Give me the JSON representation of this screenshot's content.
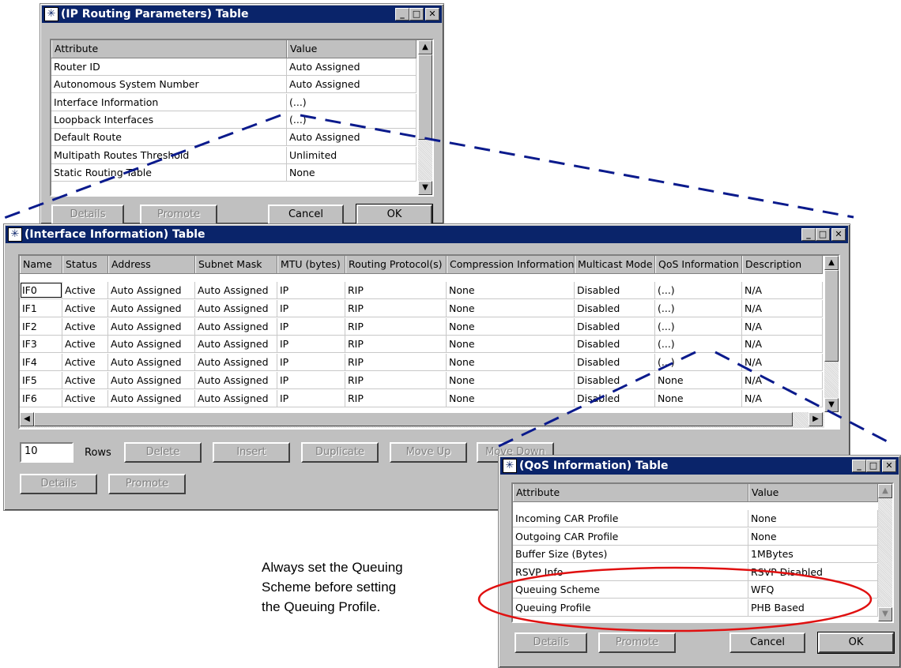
{
  "ip_window": {
    "title": "(IP Routing Parameters) Table",
    "columns": [
      "Attribute",
      "Value"
    ],
    "rows": [
      [
        "Router ID",
        "Auto Assigned"
      ],
      [
        "Autonomous System Number",
        "Auto Assigned"
      ],
      [
        "Interface Information",
        "(...)"
      ],
      [
        "Loopback Interfaces",
        "(...)"
      ],
      [
        "Default Route",
        "Auto Assigned"
      ],
      [
        "Multipath Routes Threshold",
        "Unlimited"
      ],
      [
        "Static Routing Table",
        "None"
      ]
    ],
    "buttons": {
      "details": "Details",
      "promote": "Promote",
      "cancel": "Cancel",
      "ok": "OK"
    }
  },
  "iface_window": {
    "title": "(Interface Information) Table",
    "columns": [
      "Name",
      "Status",
      "Address",
      "Subnet Mask",
      "MTU (bytes)",
      "Routing Protocol(s)",
      "Compression Information",
      "Multicast Mode",
      "QoS Information",
      "Description"
    ],
    "rows": [
      [
        "IF0",
        "Active",
        "Auto Assigned",
        "Auto Assigned",
        "IP",
        "RIP",
        "None",
        "Disabled",
        "(...)",
        "N/A"
      ],
      [
        "IF1",
        "Active",
        "Auto Assigned",
        "Auto Assigned",
        "IP",
        "RIP",
        "None",
        "Disabled",
        "(...)",
        "N/A"
      ],
      [
        "IF2",
        "Active",
        "Auto Assigned",
        "Auto Assigned",
        "IP",
        "RIP",
        "None",
        "Disabled",
        "(...)",
        "N/A"
      ],
      [
        "IF3",
        "Active",
        "Auto Assigned",
        "Auto Assigned",
        "IP",
        "RIP",
        "None",
        "Disabled",
        "(...)",
        "N/A"
      ],
      [
        "IF4",
        "Active",
        "Auto Assigned",
        "Auto Assigned",
        "IP",
        "RIP",
        "None",
        "Disabled",
        "(...)",
        "N/A"
      ],
      [
        "IF5",
        "Active",
        "Auto Assigned",
        "Auto Assigned",
        "IP",
        "RIP",
        "None",
        "Disabled",
        "None",
        "N/A"
      ],
      [
        "IF6",
        "Active",
        "Auto Assigned",
        "Auto Assigned",
        "IP",
        "RIP",
        "None",
        "Disabled",
        "None",
        "N/A"
      ]
    ],
    "rows_value": "10",
    "rows_label": "Rows",
    "buttons": {
      "delete": "Delete",
      "insert": "Insert",
      "duplicate": "Duplicate",
      "move_up": "Move Up",
      "move_down": "Move Down",
      "details": "Details",
      "promote": "Promote"
    }
  },
  "qos_window": {
    "title": "(QoS Information) Table",
    "columns": [
      "Attribute",
      "Value"
    ],
    "rows": [
      [
        "Incoming CAR Profile",
        "None"
      ],
      [
        "Outgoing CAR Profile",
        "None"
      ],
      [
        "Buffer Size (Bytes)",
        "1MBytes"
      ],
      [
        "RSVP Info",
        "RSVP Disabled"
      ],
      [
        "Queuing Scheme",
        "WFQ"
      ],
      [
        "Queuing Profile",
        "PHB Based"
      ]
    ],
    "buttons": {
      "details": "Details",
      "promote": "Promote",
      "cancel": "Cancel",
      "ok": "OK"
    }
  },
  "annotation": {
    "lines": [
      "Always set the Queuing",
      "Scheme before setting",
      "the Queuing Profile."
    ]
  },
  "colors": {
    "titlebar": "#0a246a",
    "window": "#c0c0c0",
    "highlight_ellipse": "#e01010",
    "callout_lines": "#0a1a8c"
  },
  "icons": {
    "window_icon": "asterisk-icon",
    "minimize": "minimize-icon",
    "maximize": "maximize-icon",
    "close": "close-icon"
  }
}
